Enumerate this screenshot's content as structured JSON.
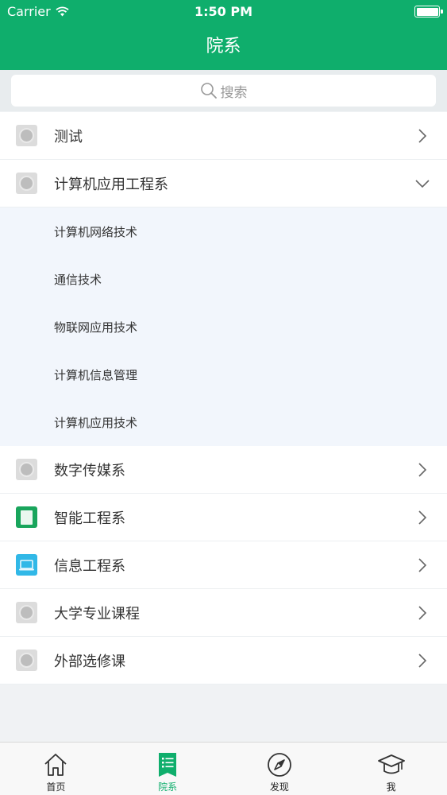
{
  "status_bar": {
    "carrier": "Carrier",
    "time": "1:50 PM"
  },
  "nav": {
    "title": "院系"
  },
  "search": {
    "placeholder": "搜索"
  },
  "departments": [
    {
      "label": "测试",
      "icon": "placeholder-coin-icon",
      "state": "collapsed"
    },
    {
      "label": "计算机应用工程系",
      "icon": "placeholder-coin-icon",
      "state": "expanded",
      "children": [
        "计算机网络技术",
        "通信技术",
        "物联网应用技术",
        "计算机信息管理",
        "计算机应用技术"
      ]
    },
    {
      "label": "数字传媒系",
      "icon": "placeholder-coin-icon",
      "state": "collapsed"
    },
    {
      "label": "智能工程系",
      "icon": "green-book-icon",
      "state": "collapsed"
    },
    {
      "label": "信息工程系",
      "icon": "blue-laptop-icon",
      "state": "collapsed"
    },
    {
      "label": "大学专业课程",
      "icon": "placeholder-coin-icon",
      "state": "collapsed"
    },
    {
      "label": "外部选修课",
      "icon": "placeholder-coin-icon",
      "state": "collapsed"
    }
  ],
  "tabs": [
    {
      "label": "首页",
      "icon": "home-icon",
      "active": false
    },
    {
      "label": "院系",
      "icon": "list-bookmark-icon",
      "active": true
    },
    {
      "label": "发现",
      "icon": "compass-icon",
      "active": false
    },
    {
      "label": "我",
      "icon": "graduation-cap-icon",
      "active": false
    }
  ],
  "colors": {
    "accent": "#0fae6c",
    "expanded_bg": "#f2f6fc",
    "page_bg": "#f0f2f4"
  }
}
